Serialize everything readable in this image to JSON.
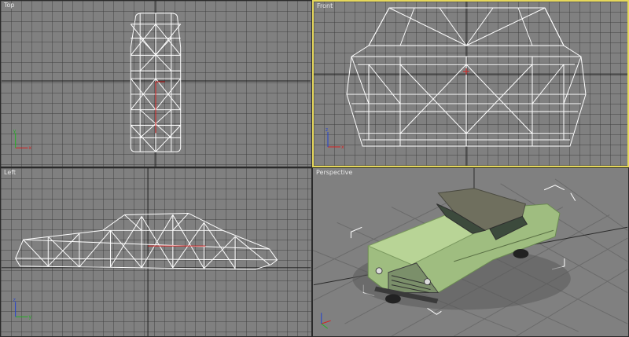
{
  "app": {
    "viewports": [
      {
        "id": "top",
        "label": "Top",
        "active": false
      },
      {
        "id": "front",
        "label": "Front",
        "active": true
      },
      {
        "id": "left",
        "label": "Left",
        "active": false
      },
      {
        "id": "perspective",
        "label": "Perspective",
        "active": false
      }
    ]
  },
  "colors": {
    "viewport_bg": "#808080",
    "grid_line": "#555555",
    "axis_line": "#1e1e1e",
    "wire": "#ffffff",
    "active_border": "#e6d85a",
    "axis_x": "#d42020",
    "axis_y": "#20b020",
    "axis_z": "#2040d0",
    "car_body": "#a8c888",
    "car_roof": "#6f6f5e"
  }
}
